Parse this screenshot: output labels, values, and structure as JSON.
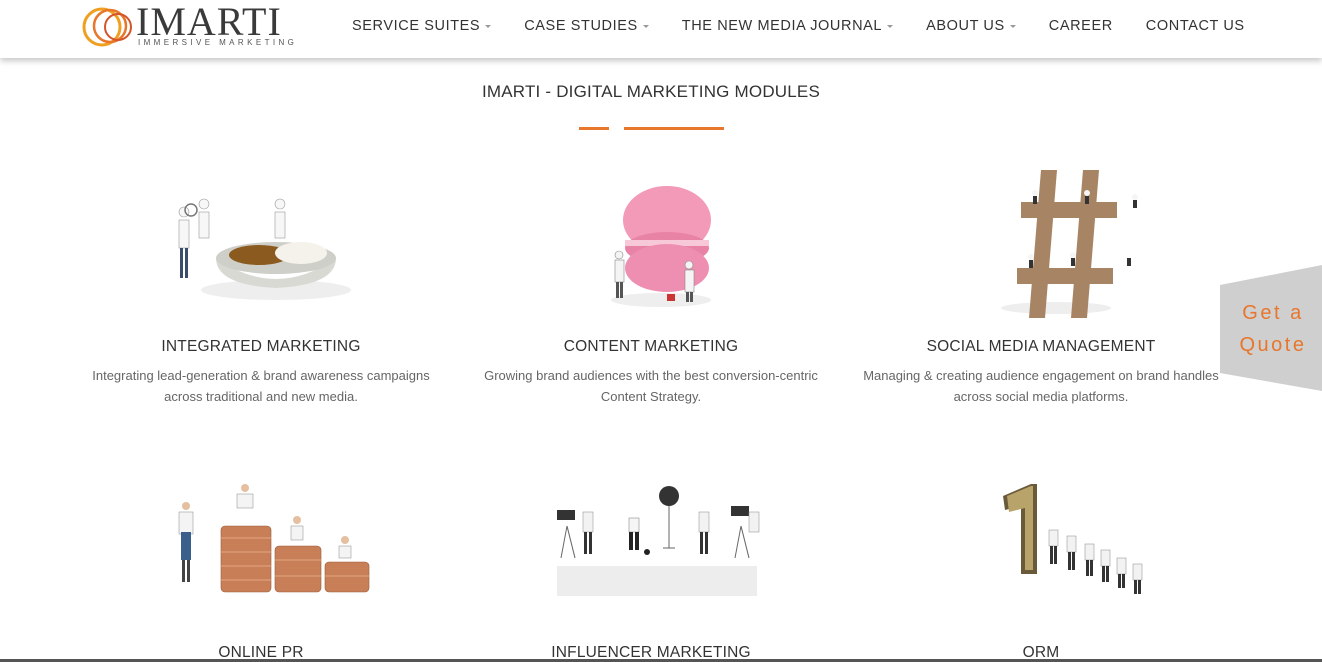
{
  "brand": {
    "name": "IMARTI",
    "tagline": "IMMERSIVE MARKETING",
    "accent_color": "#e8762b"
  },
  "nav": {
    "items": [
      {
        "label": "SERVICE SUITES",
        "has_dropdown": true
      },
      {
        "label": "CASE STUDIES",
        "has_dropdown": true
      },
      {
        "label": "THE NEW MEDIA JOURNAL",
        "has_dropdown": true
      },
      {
        "label": "ABOUT US",
        "has_dropdown": true
      },
      {
        "label": "CAREER",
        "has_dropdown": false
      },
      {
        "label": "CONTACT US",
        "has_dropdown": false
      }
    ]
  },
  "section": {
    "title": "IMARTI - DIGITAL MARKETING MODULES"
  },
  "modules": [
    {
      "title": "INTEGRATED MARKETING",
      "desc": "Integrating lead-generation & brand awareness campaigns across traditional and new media.",
      "icon": "chefs-cooking-image"
    },
    {
      "title": "CONTENT MARKETING",
      "desc": "Growing brand audiences with the best conversion-centric Content Strategy.",
      "icon": "macaron-painters-image"
    },
    {
      "title": "SOCIAL MEDIA MANAGEMENT",
      "desc": "Managing & creating audience engagement on brand handles across social media platforms.",
      "icon": "hashtag-figures-image"
    },
    {
      "title": "ONLINE PR",
      "desc": "",
      "icon": "coin-stack-readers-image"
    },
    {
      "title": "INFLUENCER MARKETING",
      "desc": "",
      "icon": "camera-crew-image"
    },
    {
      "title": "ORM",
      "desc": "",
      "icon": "number-one-queue-image"
    }
  ],
  "quote_tab": {
    "line1": "Get a",
    "line2": "Quote"
  }
}
